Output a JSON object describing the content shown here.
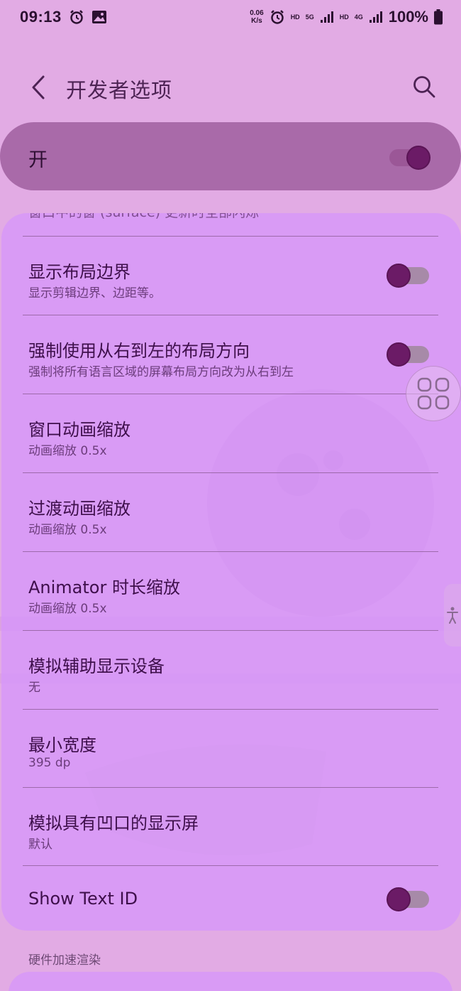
{
  "status_bar": {
    "time": "09:13",
    "net_speed_value": "0.06",
    "net_speed_unit": "K/s",
    "hd1": "HD",
    "net1": "5G",
    "hd2": "HD",
    "net2": "4G",
    "battery": "100%"
  },
  "header": {
    "title": "开发者选项"
  },
  "master": {
    "label": "开",
    "enabled": true
  },
  "list": {
    "clipped_text": "窗口中的窗 (surface) 更新时全部闪烁",
    "items": [
      {
        "title": "显示布局边界",
        "subtitle": "显示剪辑边界、边距等。",
        "toggle": false
      },
      {
        "title": "强制使用从右到左的布局方向",
        "subtitle": "强制将所有语言区域的屏幕布局方向改为从右到左",
        "toggle": false
      },
      {
        "title": "窗口动画缩放",
        "subtitle": "动画缩放 0.5x"
      },
      {
        "title": "过渡动画缩放",
        "subtitle": "动画缩放 0.5x"
      },
      {
        "title": "Animator 时长缩放",
        "subtitle": "动画缩放 0.5x"
      },
      {
        "title": "模拟辅助显示设备",
        "subtitle": "无"
      },
      {
        "title": "最小宽度",
        "subtitle": "395 dp"
      },
      {
        "title": "模拟具有凹口的显示屏",
        "subtitle": "默认"
      },
      {
        "title": "Show Text ID",
        "toggle": false
      }
    ]
  },
  "section_header": "硬件加速渲染",
  "colors": {
    "background": "#e2abe4",
    "card": "#d696fa",
    "master_bar": "#a96aa9",
    "toggle_knob": "#6b1b66"
  }
}
